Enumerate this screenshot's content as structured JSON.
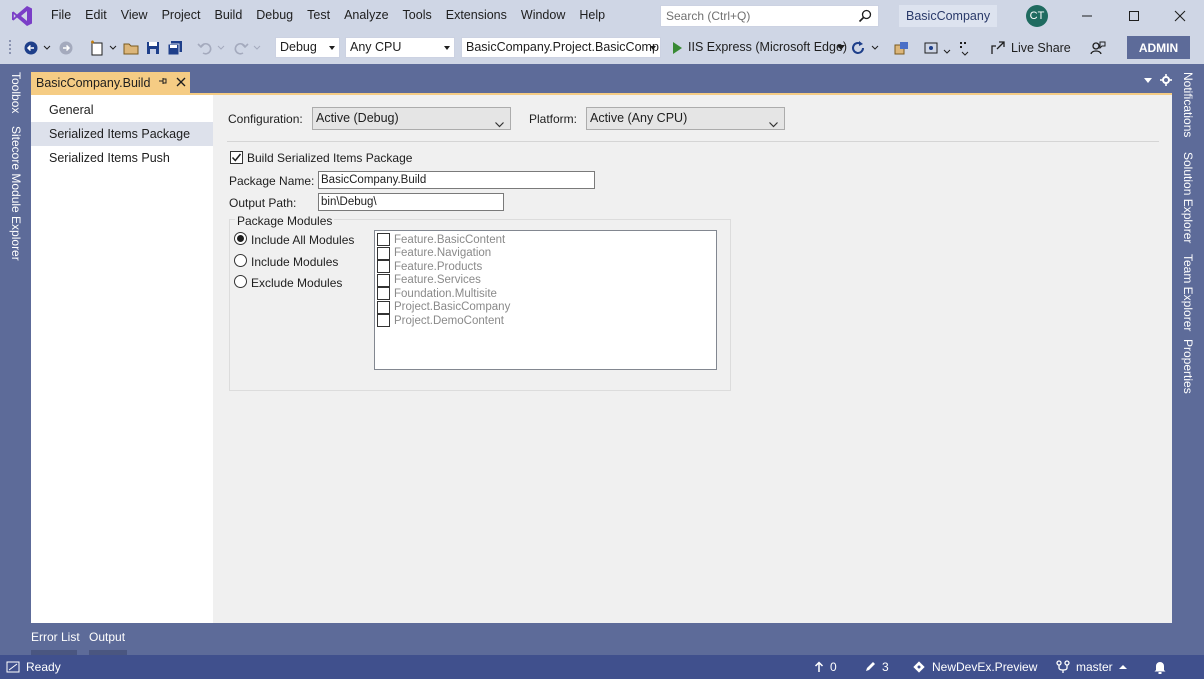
{
  "menu": [
    "File",
    "Edit",
    "View",
    "Project",
    "Build",
    "Debug",
    "Test",
    "Analyze",
    "Tools",
    "Extensions",
    "Window",
    "Help"
  ],
  "search": {
    "placeholder": "Search (Ctrl+Q)"
  },
  "solution_name": "BasicCompany",
  "avatar_initials": "CT",
  "toolbar": {
    "configuration": "Debug",
    "platform": "Any CPU",
    "startup_project": "BasicCompany.Project.BasicComp",
    "run_target": "IIS Express (Microsoft Edge)",
    "live_share": "Live Share",
    "admin": "ADMIN"
  },
  "left_rail": [
    "Toolbox",
    "Sitecore Module Explorer"
  ],
  "right_rail": [
    "Notifications",
    "Solution Explorer",
    "Team Explorer",
    "Properties"
  ],
  "document_tab": {
    "title": "BasicCompany.Build"
  },
  "nav": {
    "items": [
      {
        "label": "General"
      },
      {
        "label": "Serialized Items Package"
      },
      {
        "label": "Serialized Items Push"
      }
    ]
  },
  "page": {
    "configuration_label": "Configuration:",
    "configuration_value": "Active (Debug)",
    "platform_label": "Platform:",
    "platform_value": "Active (Any CPU)",
    "build_checkbox_label": "Build Serialized Items Package",
    "build_checked": true,
    "package_name_label": "Package Name:",
    "package_name_value": "BasicCompany.Build",
    "output_path_label": "Output Path:",
    "output_path_value": "bin\\Debug\\",
    "group_title": "Package Modules",
    "radios": [
      {
        "label": "Include All Modules",
        "selected": true
      },
      {
        "label": "Include Modules",
        "selected": false
      },
      {
        "label": "Exclude Modules",
        "selected": false
      }
    ],
    "modules": [
      "Feature.BasicContent",
      "Feature.Navigation",
      "Feature.Products",
      "Feature.Services",
      "Foundation.Multisite",
      "Project.BasicCompany",
      "Project.DemoContent"
    ]
  },
  "bottom_tabs": [
    "Error List",
    "Output"
  ],
  "status": {
    "ready": "Ready",
    "up_count": "0",
    "pencil_count": "3",
    "repo": "NewDevEx.Preview",
    "branch": "master"
  },
  "colors": {
    "chrome": "#cfd6e5",
    "frame": "#5d6b99",
    "tab_active": "#f5cc84",
    "statusbar": "#40508d"
  }
}
